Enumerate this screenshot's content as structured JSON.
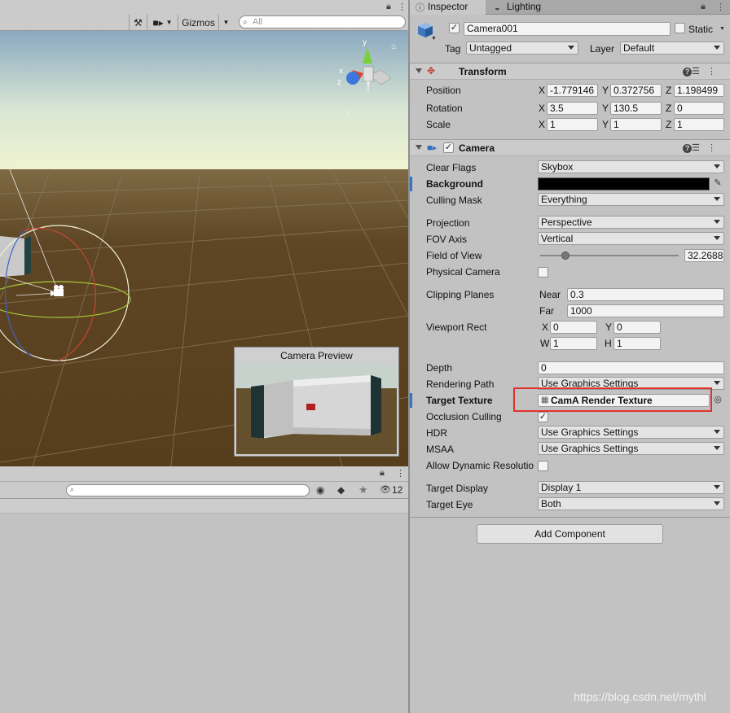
{
  "scene": {
    "toolbar": {
      "gizmos_label": "Gizmos",
      "search_placeholder": "All"
    },
    "gizmo_axes": {
      "y": "y",
      "x": "x",
      "z": "z"
    },
    "camera_preview": {
      "title": "Camera Preview"
    }
  },
  "hierarchy": {
    "visibility_count": "12"
  },
  "inspector": {
    "tabs": [
      {
        "label": "Inspector",
        "icon": "info-icon"
      },
      {
        "label": "Lighting",
        "icon": "light-bulb-icon"
      }
    ],
    "object": {
      "name": "Camera001",
      "static_label": "Static",
      "tag_label": "Tag",
      "tag_value": "Untagged",
      "layer_label": "Layer",
      "layer_value": "Default"
    },
    "transform": {
      "title": "Transform",
      "position_label": "Position",
      "position": {
        "x": "-1.779146",
        "y": "0.372756",
        "z": "1.198499"
      },
      "rotation_label": "Rotation",
      "rotation": {
        "x": "3.5",
        "y": "130.5",
        "z": "0"
      },
      "scale_label": "Scale",
      "scale": {
        "x": "1",
        "y": "1",
        "z": "1"
      }
    },
    "camera": {
      "title": "Camera",
      "clear_flags_label": "Clear Flags",
      "clear_flags": "Skybox",
      "background_label": "Background",
      "background_color": "#000000",
      "culling_mask_label": "Culling Mask",
      "culling_mask": "Everything",
      "projection_label": "Projection",
      "projection": "Perspective",
      "fov_axis_label": "FOV Axis",
      "fov_axis": "Vertical",
      "field_of_view_label": "Field of View",
      "field_of_view": "32.2688",
      "physical_camera_label": "Physical Camera",
      "clipping_planes_label": "Clipping Planes",
      "near_label": "Near",
      "near": "0.3",
      "far_label": "Far",
      "far": "1000",
      "viewport_rect_label": "Viewport Rect",
      "viewport": {
        "x": "0",
        "y": "0",
        "w": "1",
        "h": "1"
      },
      "depth_label": "Depth",
      "depth": "0",
      "rendering_path_label": "Rendering Path",
      "rendering_path": "Use Graphics Settings",
      "target_texture_label": "Target Texture",
      "target_texture": "CamA Render Texture",
      "occlusion_culling_label": "Occlusion Culling",
      "hdr_label": "HDR",
      "hdr": "Use Graphics Settings",
      "msaa_label": "MSAA",
      "msaa": "Use Graphics Settings",
      "allow_dynamic_label": "Allow Dynamic Resolutio",
      "target_display_label": "Target Display",
      "target_display": "Display 1",
      "target_eye_label": "Target Eye",
      "target_eye": "Both"
    },
    "axis_letters": {
      "x": "X",
      "y": "Y",
      "z": "Z",
      "w": "W",
      "h": "H"
    },
    "add_component_label": "Add Component"
  },
  "watermark": "https://blog.csdn.net/mythl",
  "colors": {
    "highlight": "#e0312b",
    "ground": "#5a4220",
    "sky_top": "#8aa9c0",
    "sky_horizon": "#f1f4cf"
  }
}
